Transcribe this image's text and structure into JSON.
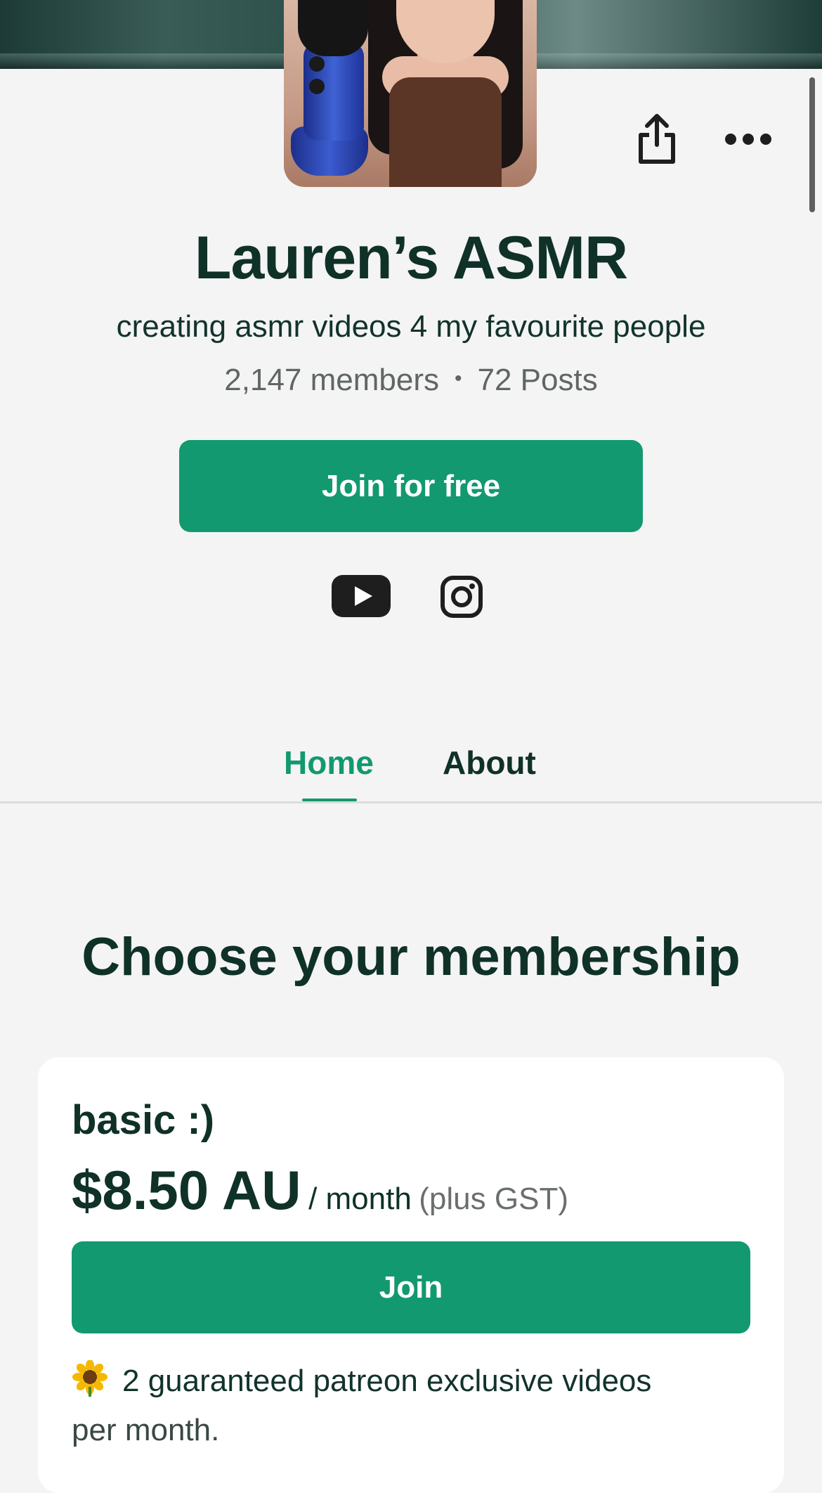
{
  "header": {
    "share_icon": "share-icon",
    "more_icon": "more-horizontal-icon"
  },
  "creator": {
    "name": "Lauren’s ASMR",
    "tagline": "creating asmr videos 4 my favourite people",
    "members": "2,147 members",
    "separator": "•",
    "posts": "72 Posts",
    "join_free_label": "Join for free"
  },
  "social": {
    "youtube_icon": "youtube-icon",
    "instagram_icon": "instagram-icon"
  },
  "tabs": [
    {
      "label": "Home",
      "active": true
    },
    {
      "label": "About",
      "active": false
    }
  ],
  "membership": {
    "section_title": "Choose your membership",
    "tiers": [
      {
        "name": "basic :)",
        "price": "$8.50 AU",
        "period": "/ month",
        "tax_note": "(plus GST)",
        "join_label": "Join",
        "benefit_line1": "2 guaranteed patreon exclusive videos",
        "benefit_line2": "per month."
      }
    ]
  },
  "colors": {
    "accent": "#12996f",
    "heading": "#0f3128",
    "background": "#f4f4f4"
  }
}
